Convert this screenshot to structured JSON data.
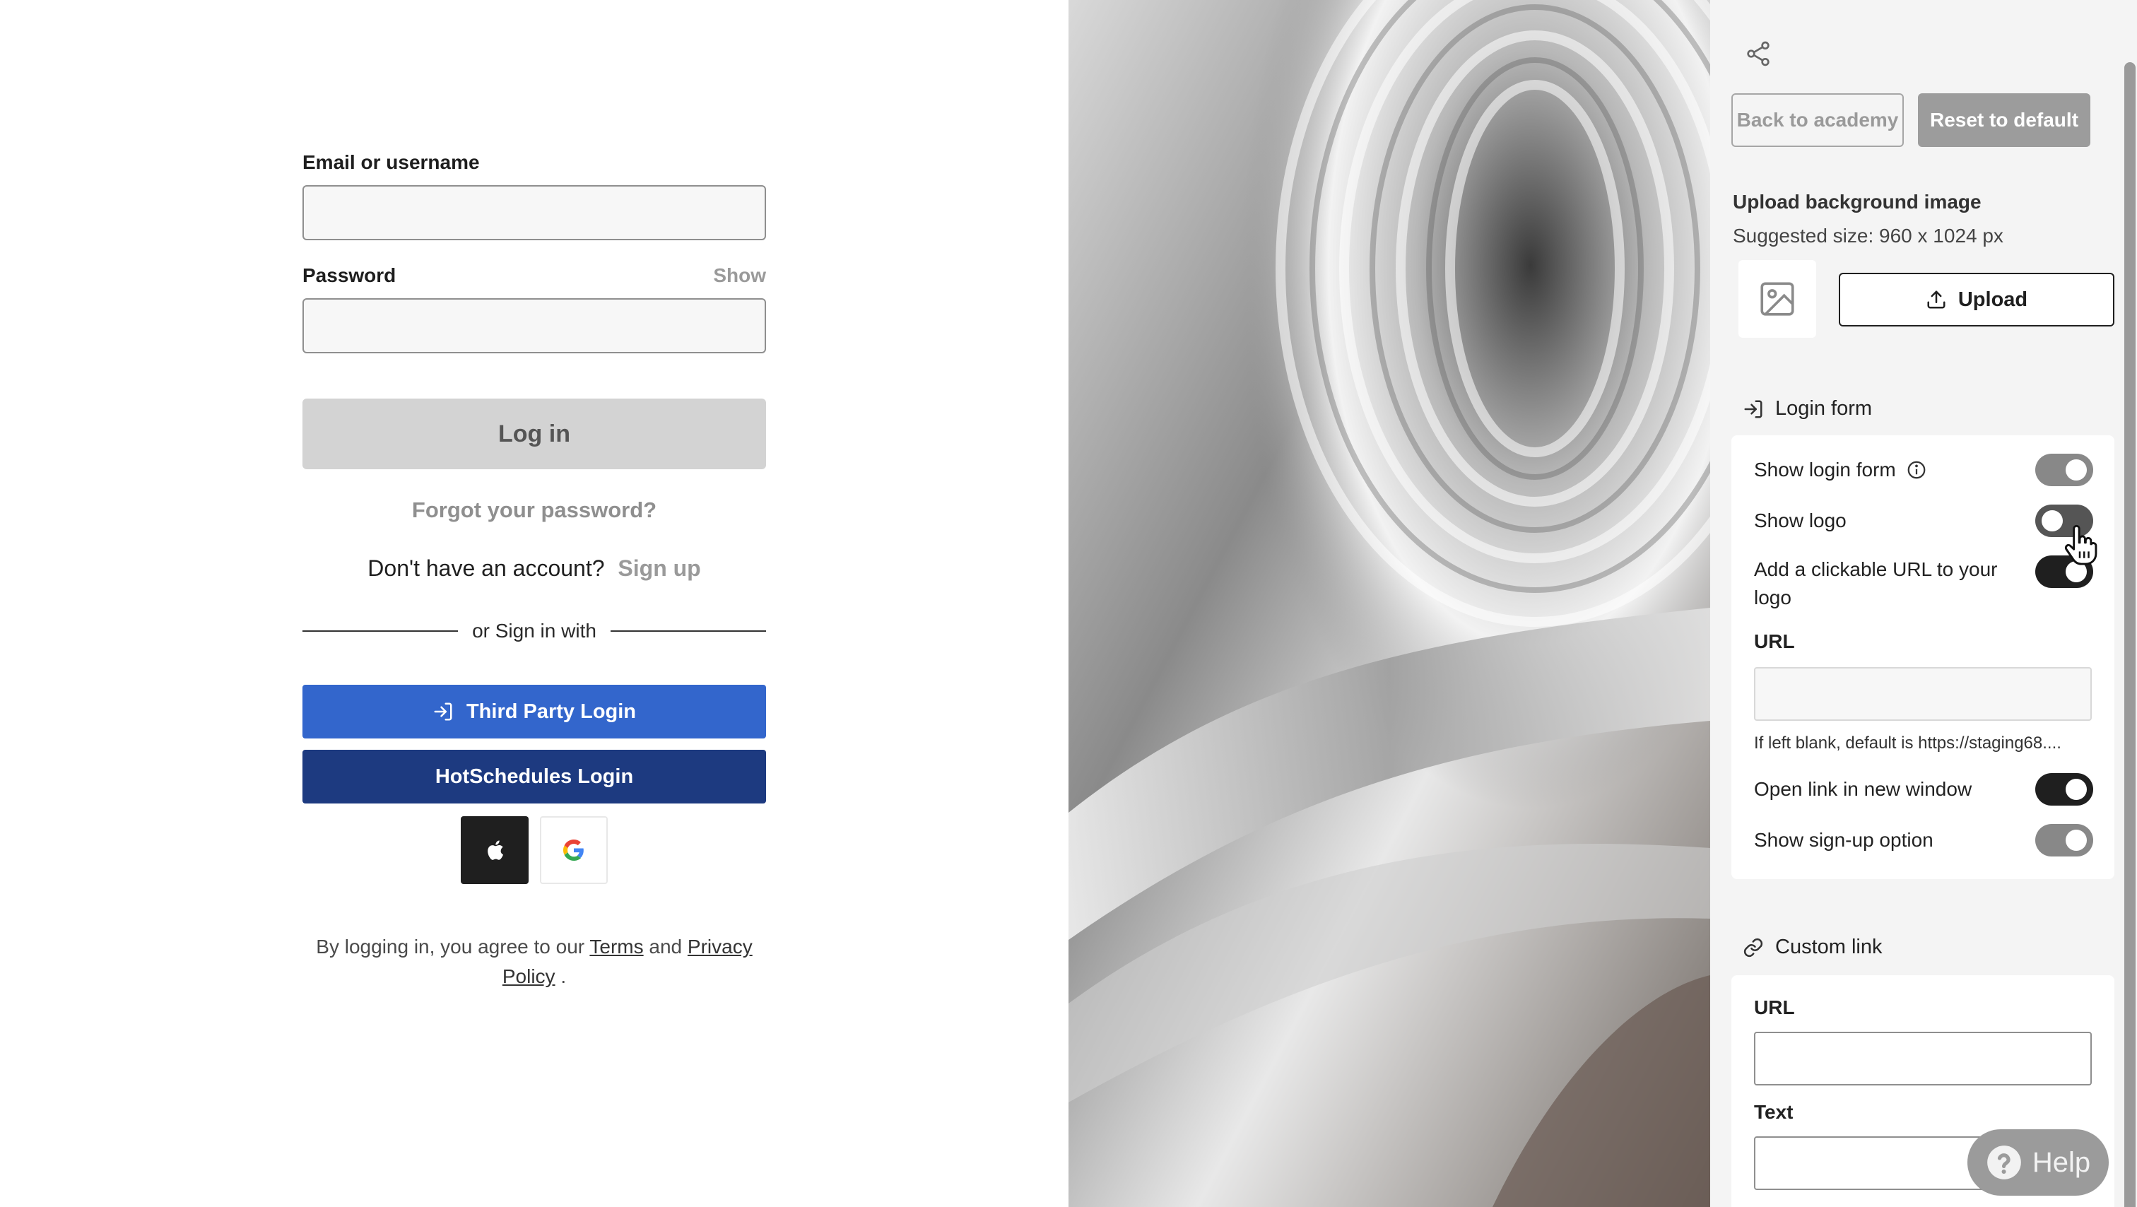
{
  "login": {
    "email_label": "Email or username",
    "password_label": "Password",
    "show_label": "Show",
    "login_button": "Log in",
    "forgot": "Forgot your password?",
    "no_account": "Don't have an account?",
    "sign_up": "Sign up",
    "divider": "or Sign in with",
    "third_party_button": "Third Party Login",
    "hotschedules_button": "HotSchedules Login",
    "terms_prefix": "By logging in, you agree to our",
    "terms_link": "Terms",
    "terms_and": "and",
    "privacy_link_1": "Privacy",
    "privacy_link_2": "Policy",
    "terms_suffix": "."
  },
  "panel": {
    "back_button": "Back to academy",
    "reset_button": "Reset to default",
    "upload_title": "Upload background image",
    "upload_size": "Suggested size: 960 x 1024 px",
    "upload_button": "Upload",
    "login_form_section": "Login form",
    "toggles": {
      "show_login_form": "Show login form",
      "show_logo": "Show logo",
      "clickable_url_1": "Add a clickable URL to your",
      "clickable_url_2": "logo",
      "open_new_window": "Open link in new window",
      "show_signup": "Show sign-up option"
    },
    "url_label": "URL",
    "url_hint": "If left blank, default is https://staging68....",
    "custom_link_section": "Custom link",
    "custom_url_label": "URL",
    "custom_text_label": "Text"
  },
  "help": {
    "label": "Help"
  },
  "colors": {
    "third_party_blue": "#3366cc",
    "hotschedules_navy": "#1d3a80",
    "toggle_dark": "#1f1f1f",
    "toggle_grey": "#888888"
  }
}
